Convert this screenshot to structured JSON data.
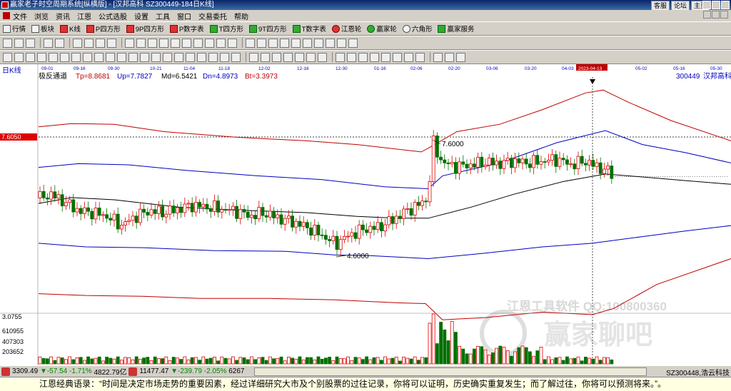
{
  "window": {
    "title": "赢家老子时空周期系统[纵横版] - [汉邦高科  SZ300449-184日K线]",
    "links": [
      "客服",
      "论坛",
      "主页"
    ]
  },
  "menu": [
    "文件",
    "浏览",
    "资讯",
    "江恩",
    "公式选股",
    "设置",
    "工具",
    "窗口",
    "交易委托",
    "帮助"
  ],
  "toolbar1": [
    "行情",
    "板块",
    "K线",
    "P四方形",
    "9P四方形",
    "P数字表",
    "T四方形",
    "9T四方形",
    "T数字表",
    "江恩轮",
    "赢家轮",
    "六角形",
    "赢家服务"
  ],
  "chart": {
    "period_label": "日K线",
    "indicator_name": "极反通道",
    "indicators": [
      {
        "label": "Tp=8.8681",
        "color": "#c00000"
      },
      {
        "label": "Up=7.7827",
        "color": "#0000c0"
      },
      {
        "label": "Md=6.5421",
        "color": "#000000"
      },
      {
        "label": "Dn=4.8973",
        "color": "#0000c0"
      },
      {
        "label": "Bt=3.3973",
        "color": "#c00000"
      }
    ],
    "stock_code": "300449",
    "stock_name": "汉邦高科",
    "price_marker": "7.6050",
    "highlight_date": "2023-04-13",
    "date_ticks": [
      "09-01",
      "09-16",
      "09-30",
      "10-21",
      "11-04",
      "11-18",
      "12-02",
      "12-16",
      "12-30",
      "01-16",
      "02-06",
      "02-20",
      "03-06",
      "03-20",
      "04-03",
      "2023-04-13",
      "05-02",
      "05-16",
      "05-30"
    ],
    "high_label": "7.6000",
    "low_label": "4.6000",
    "watermark_line1": "江恩工具软件  QQ:100800360",
    "watermark_logo": "赢家聊吧",
    "volume_ticks": [
      "3.0755",
      "610955",
      "407303",
      "203652"
    ]
  },
  "chart_data": {
    "type": "candlestick",
    "title": "300449 汉邦高科 日K线",
    "x_range": [
      "09-01",
      "05-30"
    ],
    "y_range": [
      3.0,
      9.0
    ],
    "current_price": 7.605,
    "peak_high": 7.6,
    "trough_low": 4.6,
    "series": [
      {
        "name": "Tp",
        "last": 8.8681
      },
      {
        "name": "Up",
        "last": 7.7827
      },
      {
        "name": "Md",
        "last": 6.5421
      },
      {
        "name": "Dn",
        "last": 4.8973
      },
      {
        "name": "Bt",
        "last": 3.3973
      }
    ],
    "volume_axis": [
      203652,
      407303,
      610955
    ]
  },
  "status": {
    "index1": "3309.49",
    "change1": "▼-57.54",
    "pct1": "-1.71%",
    "amount1": "4822.79亿",
    "index2": "11477.47",
    "change2": "▼-239.79",
    "pct2": "-2.05%",
    "amount2": "6267",
    "right": "SZ300448,浩云科技"
  },
  "quote": "江恩经典语录：“时间是决定市场走势的重要因素，经过详细研究大市及个别股票的过往记录，你将可以证明，历史确实重复发生；而了解过往，你将可以预测将来。”。"
}
